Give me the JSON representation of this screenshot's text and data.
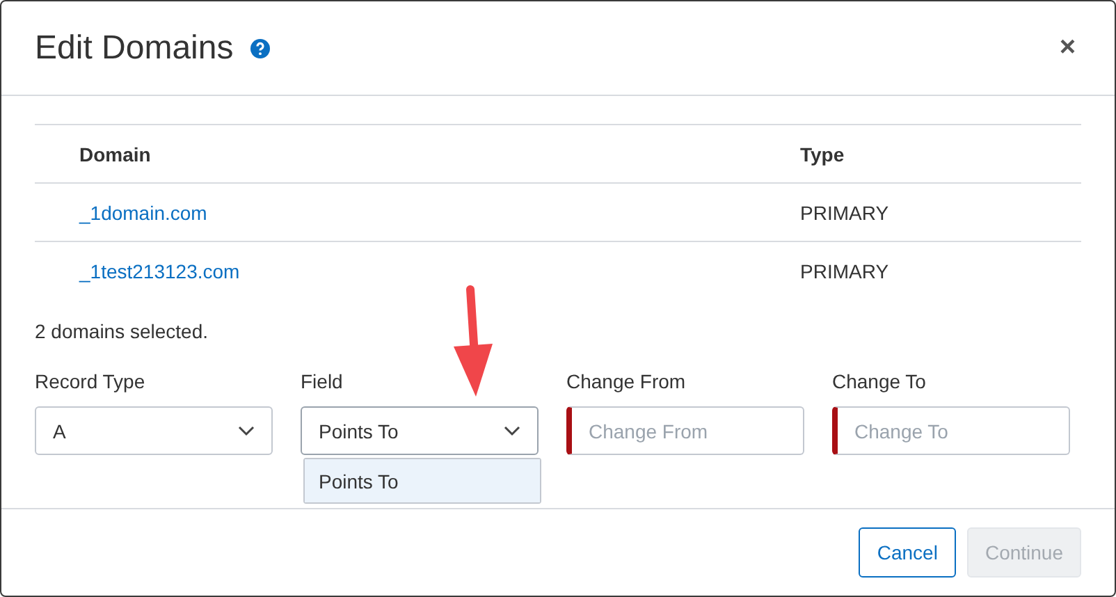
{
  "dialog": {
    "title": "Edit Domains",
    "close": "×"
  },
  "table": {
    "columns": [
      "Domain",
      "Type"
    ],
    "rows": [
      {
        "domain": "_1domain.com",
        "type": "PRIMARY"
      },
      {
        "domain": "_1test213123.com",
        "type": "PRIMARY"
      }
    ]
  },
  "selection_note": "2 domains selected.",
  "fields": [
    {
      "kind": "select",
      "label": "Record Type",
      "value": "A",
      "expanded": false
    },
    {
      "kind": "select",
      "label": "Field",
      "value": "Points To",
      "expanded": true,
      "options": [
        {
          "label": "Points To",
          "selected": true
        }
      ]
    },
    {
      "kind": "input",
      "label": "Change From",
      "placeholder": "Change From",
      "invalid": true
    },
    {
      "kind": "input",
      "label": "Change To",
      "placeholder": "Change To",
      "invalid": true
    }
  ],
  "buttons": [
    {
      "label": "Cancel",
      "kind": "secondary",
      "disabled": false
    },
    {
      "label": "Continue",
      "kind": "primary",
      "disabled": true
    }
  ]
}
